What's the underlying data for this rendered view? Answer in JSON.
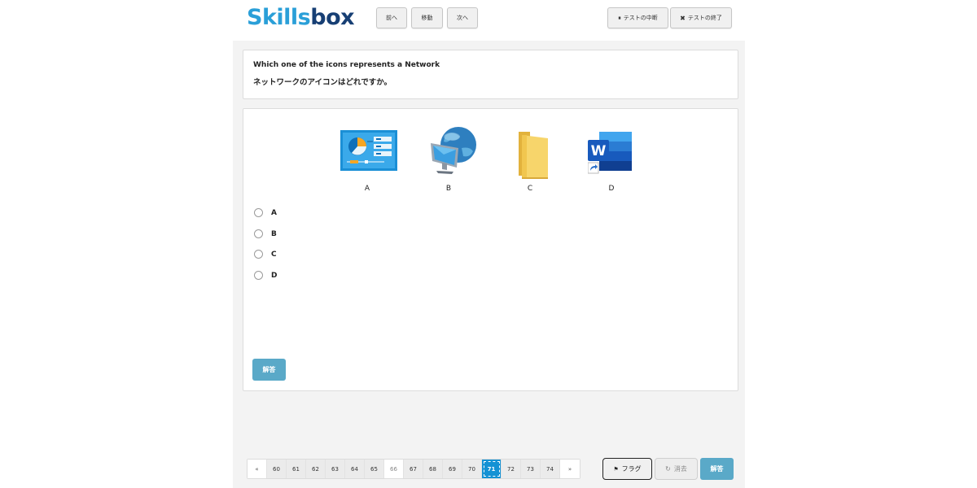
{
  "logo": {
    "part1": "Skills",
    "part2": "box"
  },
  "toolbar": {
    "prev_label": "前へ",
    "move_label": "移動",
    "next_label": "次へ",
    "pause_label": "テストの中断",
    "end_label": "テストの終了"
  },
  "question": {
    "english": "Which one of the icons represents a Network",
    "japanese": "ネットワークのアイコンはどれですか。"
  },
  "icons": [
    {
      "label": "A",
      "icon": "dashboard-icon"
    },
    {
      "label": "B",
      "icon": "network-globe-icon"
    },
    {
      "label": "C",
      "icon": "folder-icon"
    },
    {
      "label": "D",
      "icon": "word-shortcut-icon"
    }
  ],
  "options": [
    "A",
    "B",
    "C",
    "D"
  ],
  "answer_label": "解答",
  "pager": {
    "prev": "«",
    "next": "»",
    "pages": [
      "60",
      "61",
      "62",
      "63",
      "64",
      "65",
      "66",
      "67",
      "68",
      "69",
      "70",
      "71",
      "72",
      "73",
      "74"
    ],
    "current": "71",
    "unvisited": "66"
  },
  "bottom": {
    "flag_label": "フラグ",
    "clear_label": "消去",
    "answer_label": "解答"
  },
  "colors": {
    "accent": "#1592d4",
    "answer_button": "#5aa9c8",
    "logo_light": "#2a9fd8",
    "logo_dark": "#173f74"
  }
}
